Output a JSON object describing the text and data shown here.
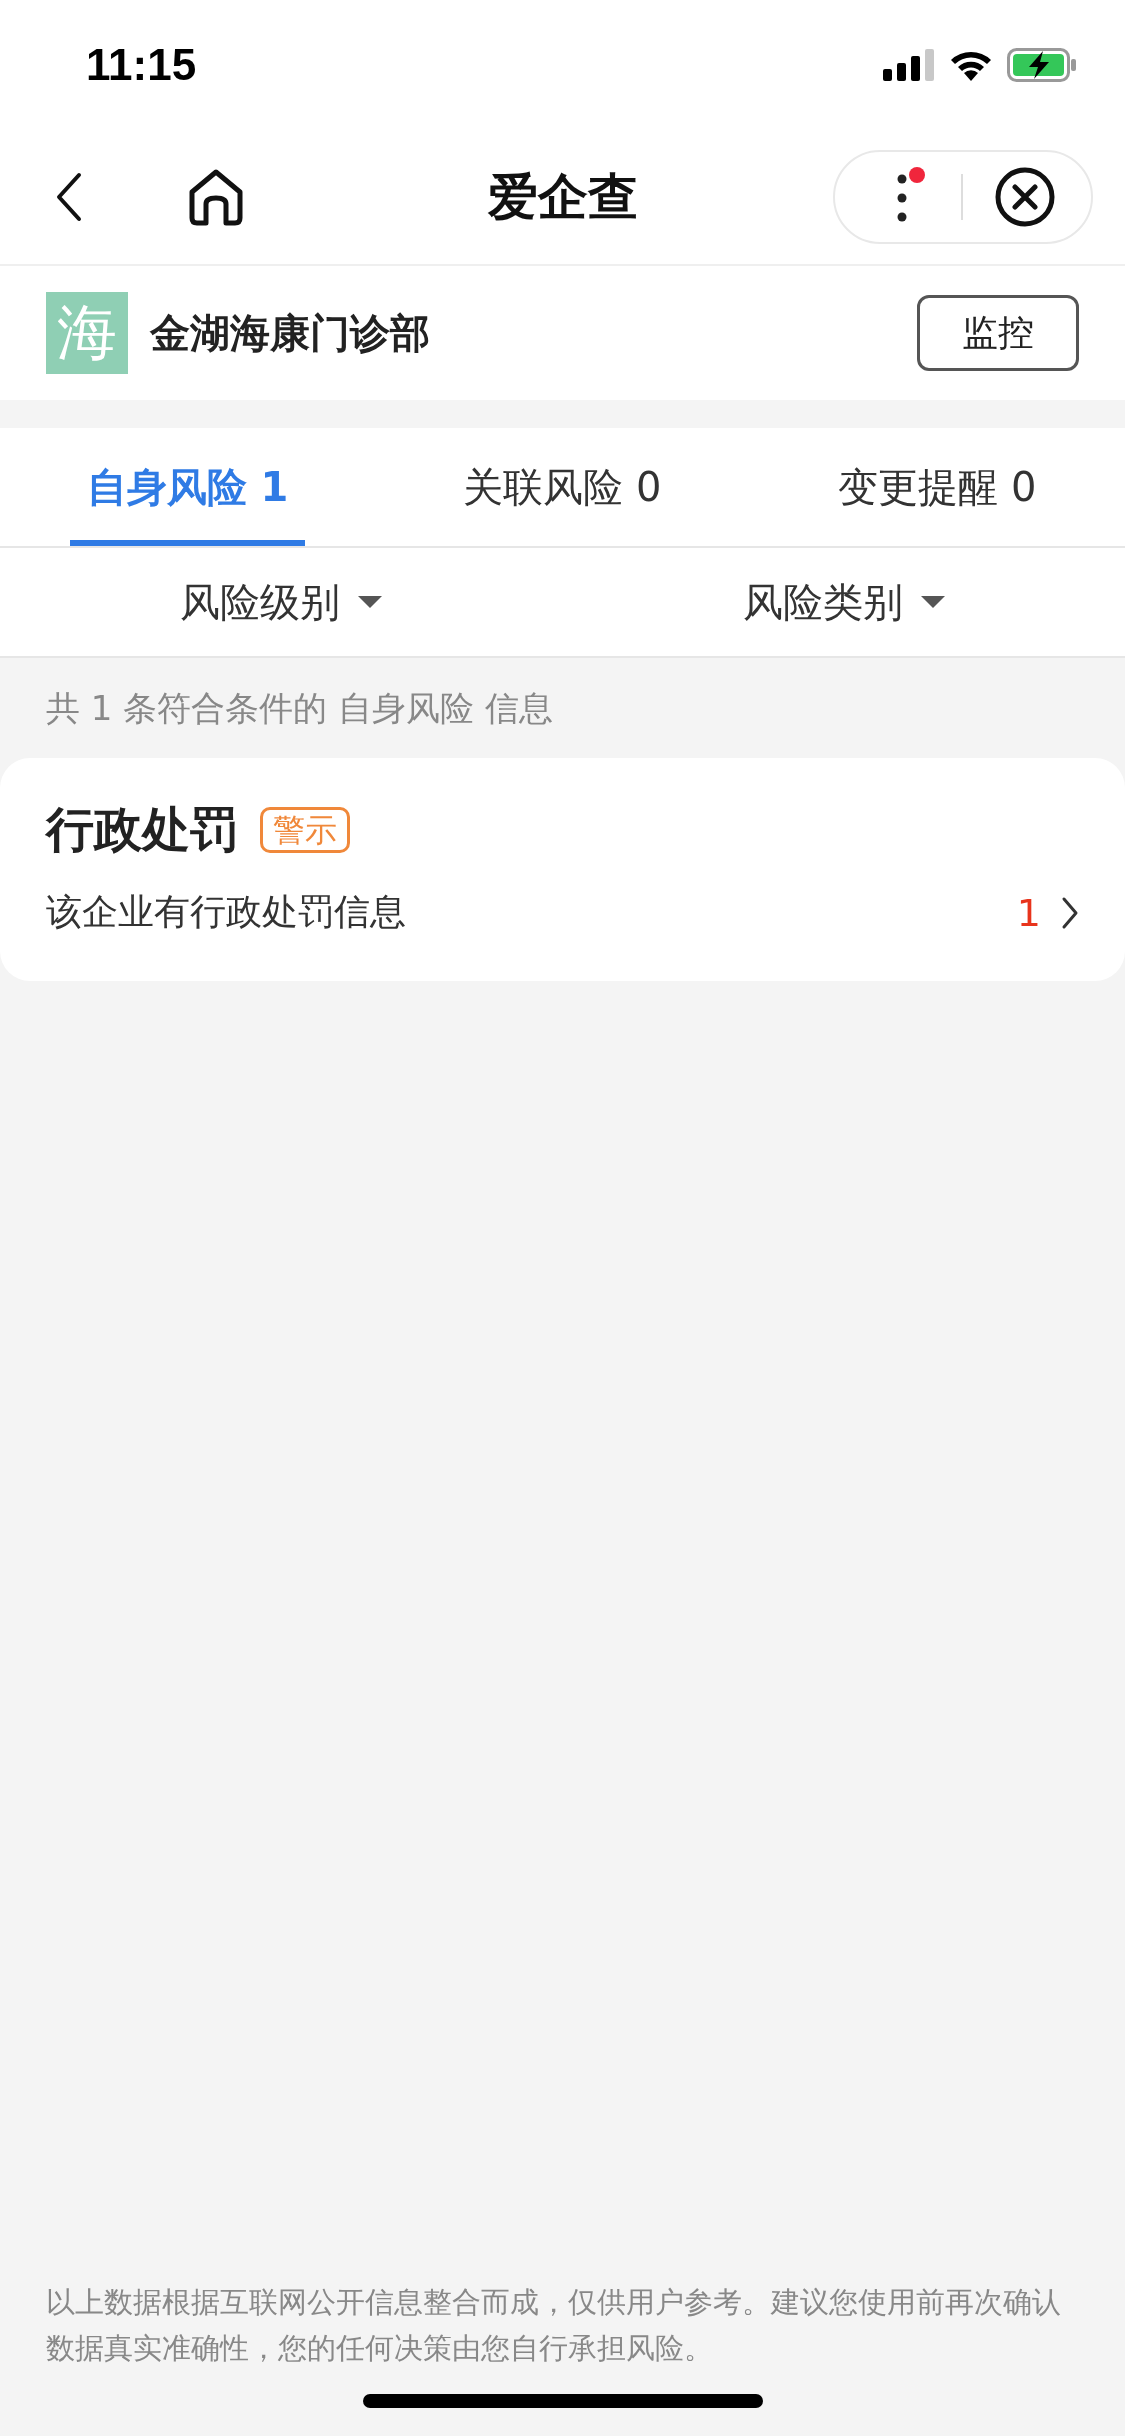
{
  "status_bar": {
    "time": "11:15"
  },
  "nav": {
    "title": "爱企查",
    "notification_dot": true
  },
  "company": {
    "logo_char": "海",
    "name": "金湖海康门诊部",
    "button": "监控"
  },
  "tabs": [
    {
      "label": "自身风险 1",
      "selected": true
    },
    {
      "label": "关联风险 0",
      "selected": false
    },
    {
      "label": "变更提醒 0",
      "selected": false
    }
  ],
  "filters": [
    {
      "label": "风险级别"
    },
    {
      "label": "风险类别"
    }
  ],
  "summary": "共 1 条符合条件的 自身风险 信息",
  "risks": [
    {
      "title": "行政处罚",
      "tag": "警示",
      "description": "该企业有行政处罚信息",
      "count": "1"
    }
  ],
  "footer": "以上数据根据互联网公开信息整合而成，仅供用户参考。建议您使用前再次确认数据真实准确性，您的任何决策由您自行承担风险。"
}
